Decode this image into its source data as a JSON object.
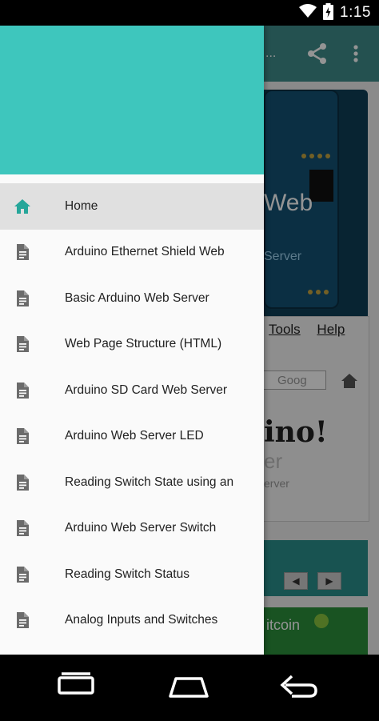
{
  "status_bar": {
    "time": "1:15",
    "icons": [
      "wifi-icon",
      "battery-charging-icon"
    ]
  },
  "app_background": {
    "appbar_title": "...",
    "hero_text": "Web",
    "hero_sub": "Server",
    "browser_menu": [
      "Tools",
      "Help"
    ],
    "search_placeholder": "Goog",
    "big_text": "ino!",
    "small_text": "er",
    "tiny_text": "erver",
    "coin_text": "itcoin"
  },
  "drawer": {
    "header_color": "#3ec6bd",
    "items": [
      {
        "label": "Home",
        "icon": "home-icon",
        "active": true
      },
      {
        "label": "Arduino Ethernet Shield Web",
        "icon": "document-icon",
        "active": false
      },
      {
        "label": "Basic Arduino Web Server",
        "icon": "document-icon",
        "active": false
      },
      {
        "label": "Web Page Structure (HTML)",
        "icon": "document-icon",
        "active": false
      },
      {
        "label": "Arduino SD Card Web Server",
        "icon": "document-icon",
        "active": false
      },
      {
        "label": "Arduino Web Server LED",
        "icon": "document-icon",
        "active": false
      },
      {
        "label": "Reading Switch State using an",
        "icon": "document-icon",
        "active": false
      },
      {
        "label": "Arduino Web Server Switch",
        "icon": "document-icon",
        "active": false
      },
      {
        "label": "Reading Switch Status",
        "icon": "document-icon",
        "active": false
      },
      {
        "label": "Analog Inputs and Switches",
        "icon": "document-icon",
        "active": false
      }
    ]
  },
  "nav_bar": {
    "buttons": [
      "recent-apps-icon",
      "home-nav-icon",
      "back-icon"
    ]
  },
  "colors": {
    "accent": "#3ec6bd",
    "home_icon": "#26a69a",
    "appbar": "#3f8c8a"
  }
}
